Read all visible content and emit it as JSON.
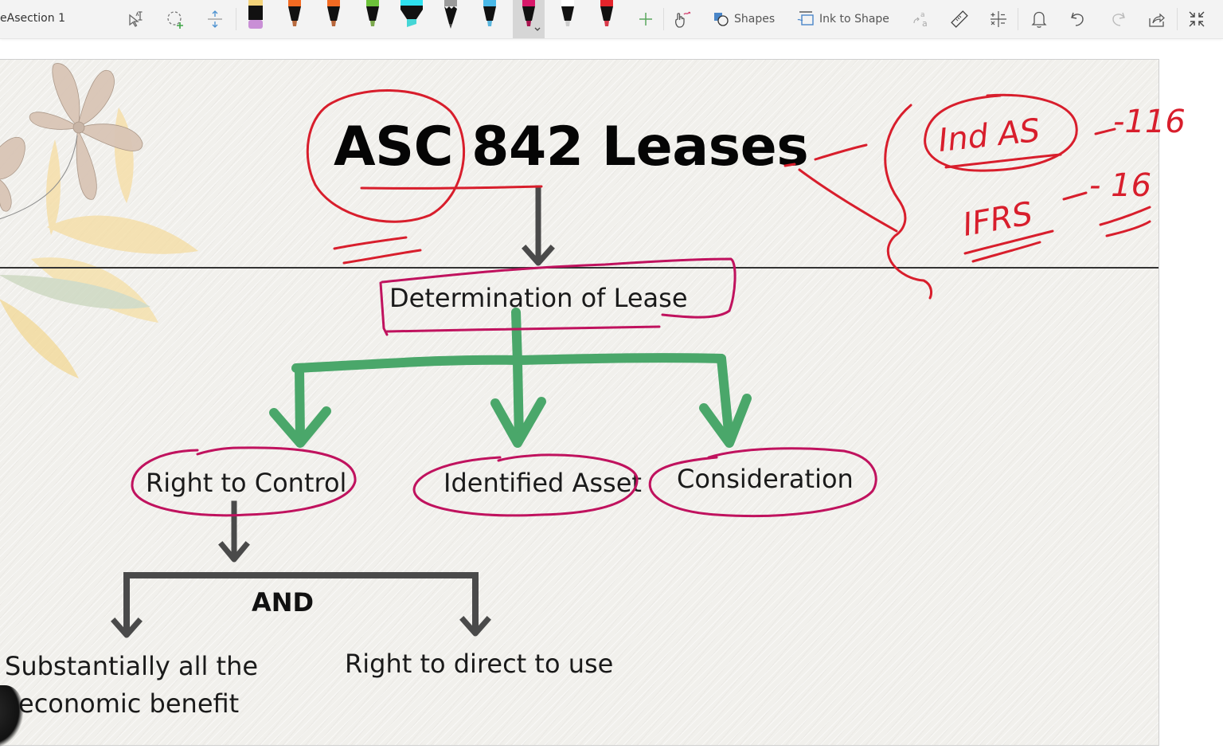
{
  "toolbar": {
    "section_title": "eAsection 1",
    "tools": [
      {
        "name": "lasso-select-text-icon",
        "label": "Select text"
      },
      {
        "name": "lasso-add-icon",
        "label": "Lasso select"
      },
      {
        "name": "add-space-icon",
        "label": "Add space"
      }
    ],
    "pens": [
      {
        "name": "pen-eraser",
        "cap": "#f3d37a",
        "tip": "#c98fd6",
        "type": "eraser"
      },
      {
        "name": "pen-orange-1",
        "cap": "#f26a22",
        "tip": "#b86a3e",
        "type": "pen"
      },
      {
        "name": "pen-orange-2",
        "cap": "#f26a22",
        "tip": "#b8663a",
        "type": "pen"
      },
      {
        "name": "pen-green",
        "cap": "#6cc23a",
        "tip": "#7aa84c",
        "type": "pen"
      },
      {
        "name": "highlighter-cyan",
        "cap": "#2ee0ee",
        "tip": "#45d6d6",
        "type": "highlighter"
      },
      {
        "name": "pencil-gray",
        "cap": "#9a9a9a",
        "tip": "#444444",
        "type": "pencil"
      },
      {
        "name": "pen-blue",
        "cap": "#49b8e8",
        "tip": "#5ab5dd",
        "type": "pen"
      },
      {
        "name": "pen-magenta",
        "cap": "#d8186a",
        "tip": "#a8144f",
        "type": "pen",
        "selected": true
      },
      {
        "name": "pen-white",
        "cap": "#ffffff",
        "tip": "#cccccc",
        "type": "pen"
      },
      {
        "name": "pen-red",
        "cap": "#e3242b",
        "tip": "#d83a4a",
        "type": "pen"
      }
    ],
    "add_pen_label": "Add pen",
    "touch_draw_label": "Draw with touch",
    "shapes_label": "Shapes",
    "ink_to_shape_label": "Ink to Shape",
    "ink_to_text_label": "Ink to Text",
    "ruler_label": "Ruler",
    "math_label": "Math",
    "replay_label": "Ink Replay",
    "undo_label": "Undo",
    "redo_label": "Redo",
    "share_label": "Share",
    "collapse_label": "Exit full screen"
  },
  "page": {
    "title": "ASC 842 Leases",
    "root_node": "Determination of Lease",
    "criteria": [
      "Right to Control",
      "Identified Asset",
      "Consideration"
    ],
    "connector_label": "AND",
    "control_conditions": [
      {
        "line1": "Substantially all the",
        "line2": "economic benefit"
      },
      {
        "line1": "Right to direct to use",
        "line2": ""
      }
    ],
    "annotations": {
      "standard_1": "Ind AS",
      "standard_1_number": "-116",
      "standard_2": "IFRS",
      "standard_2_number": "- 16"
    }
  },
  "colors": {
    "ink_red": "#d81e2c",
    "ink_magenta": "#c0125e",
    "ink_green": "#4aa76a",
    "arrow_gray": "#4a4a4a",
    "page_bg": "#f1f0ec"
  }
}
